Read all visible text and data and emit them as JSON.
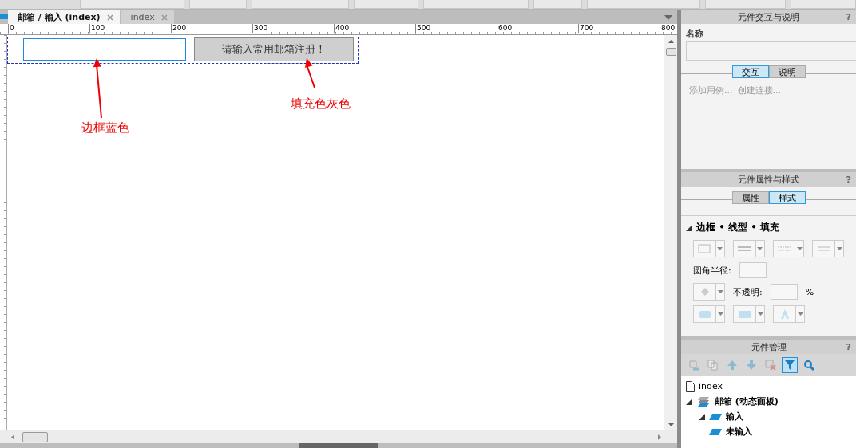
{
  "tabs": [
    {
      "label": "邮箱 / 输入 (index)",
      "selected": true
    },
    {
      "label": "index",
      "selected": false
    }
  ],
  "ruler": {
    "labels": [
      "0",
      "100",
      "200",
      "300",
      "400",
      "500",
      "600",
      "700",
      "800"
    ]
  },
  "canvas": {
    "button": {
      "label": "请输入常用邮箱注册！"
    },
    "annotations": [
      {
        "text": "边框蓝色",
        "kind": "field"
      },
      {
        "text": "填充色灰色",
        "kind": "button"
      }
    ]
  },
  "interaction_panel": {
    "title": "元件交互与说明",
    "help": "?",
    "name_label": "名称",
    "tabs": [
      {
        "label": "交互",
        "selected": true
      },
      {
        "label": "说明",
        "selected": false
      }
    ],
    "links": [
      "添加用例...",
      "创建连接..."
    ]
  },
  "style_panel": {
    "title": "元件属性与样式",
    "help": "?",
    "tabs": [
      {
        "label": "属性",
        "selected": false
      },
      {
        "label": "样式",
        "selected": true
      }
    ],
    "section": {
      "title": "边框 • 线型 • 填充",
      "expanded": true
    },
    "corner_label": "圆角半径:",
    "opacity_label": "不透明:",
    "percent": "%"
  },
  "outline_panel": {
    "title": "元件管理",
    "help": "?",
    "tools": [
      {
        "kind": "add",
        "selected": false
      },
      {
        "kind": "copy",
        "selected": false
      },
      {
        "kind": "up",
        "selected": false
      },
      {
        "kind": "down",
        "selected": false
      },
      {
        "kind": "delete",
        "selected": false
      },
      {
        "kind": "filter",
        "selected": true
      },
      {
        "kind": "search",
        "selected": false
      }
    ],
    "tree": [
      {
        "label": "index",
        "kind": "page"
      },
      {
        "label": "邮箱 (动态面板)",
        "kind": "panel",
        "expanded": true,
        "children": [
          {
            "label": "输入",
            "kind": "state",
            "expanded": true
          },
          {
            "label": "未输入",
            "kind": "state"
          }
        ]
      }
    ]
  }
}
